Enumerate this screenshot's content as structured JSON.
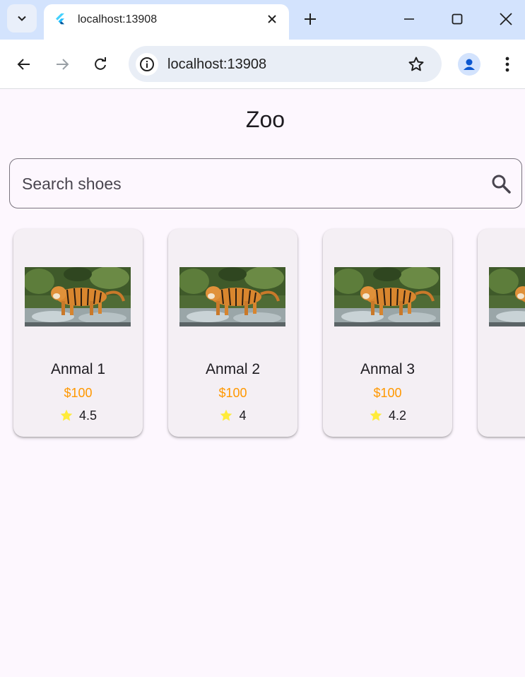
{
  "browser": {
    "tab_title": "localhost:13908",
    "url": "localhost:13908"
  },
  "app": {
    "title": "Zoo",
    "search_placeholder": "Search shoes",
    "accent_color": "#ff9800",
    "star_color": "#ffeb3b"
  },
  "cards": [
    {
      "name": "Anmal 1",
      "price": "$100",
      "rating": "4.5",
      "image": "tiger-image"
    },
    {
      "name": "Anmal 2",
      "price": "$100",
      "rating": "4",
      "image": "tiger-image"
    },
    {
      "name": "Anmal 3",
      "price": "$100",
      "rating": "4.2",
      "image": "tiger-image"
    },
    {
      "name": "An",
      "price": "",
      "rating": "",
      "image": "tiger-image"
    }
  ]
}
